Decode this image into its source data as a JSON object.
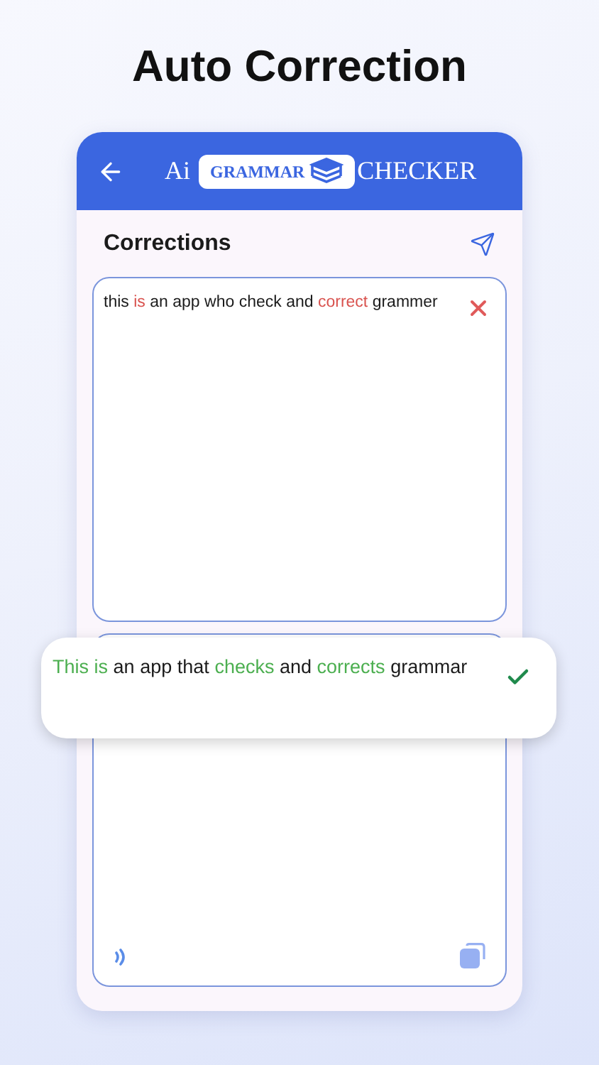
{
  "headline": "Auto Correction",
  "app_bar": {
    "logo": {
      "prefix": "Ai",
      "badge": "GRAMMAR",
      "suffix": "CHECKER"
    }
  },
  "section": {
    "title": "Corrections"
  },
  "input": {
    "words": [
      {
        "text": "this",
        "kind": "plain"
      },
      {
        "text": "is",
        "kind": "error"
      },
      {
        "text": "an",
        "kind": "plain"
      },
      {
        "text": "app",
        "kind": "plain"
      },
      {
        "text": "who",
        "kind": "plain"
      },
      {
        "text": "check",
        "kind": "plain"
      },
      {
        "text": "and",
        "kind": "plain"
      },
      {
        "text": "correct",
        "kind": "error"
      },
      {
        "text": "grammer",
        "kind": "plain"
      }
    ]
  },
  "result": {
    "words": [
      {
        "text": "This",
        "kind": "fixed"
      },
      {
        "text": "is",
        "kind": "fixed"
      },
      {
        "text": "an",
        "kind": "plain"
      },
      {
        "text": "app",
        "kind": "plain"
      },
      {
        "text": "that",
        "kind": "plain"
      },
      {
        "text": "checks",
        "kind": "fixed"
      },
      {
        "text": "and",
        "kind": "plain"
      },
      {
        "text": "corrects",
        "kind": "fixed"
      },
      {
        "text": "grammar",
        "kind": "plain"
      }
    ]
  }
}
